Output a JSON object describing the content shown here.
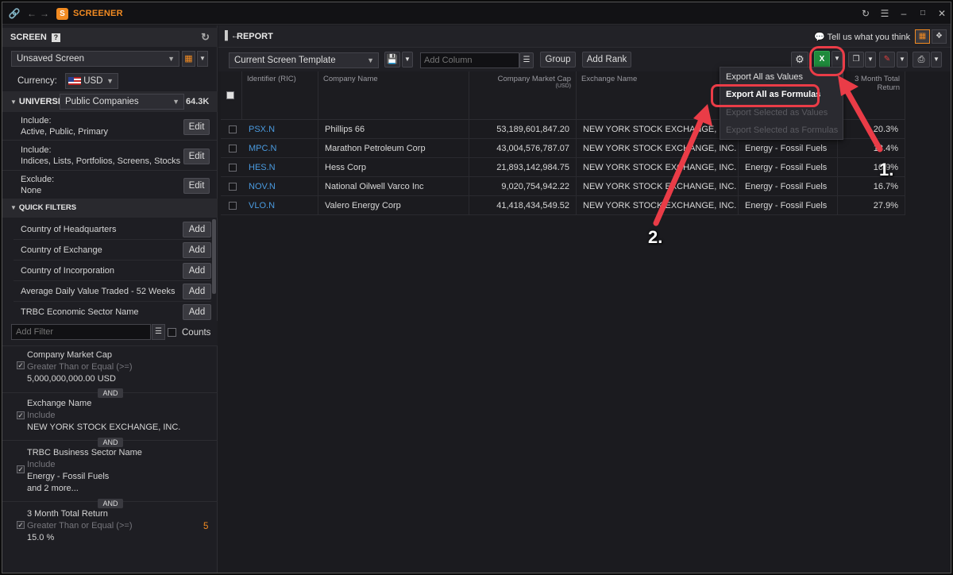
{
  "app": {
    "title": "SCREENER"
  },
  "screen_panel": {
    "title": "SCREEN",
    "screen_select": "Unsaved Screen",
    "currency_label": "Currency:",
    "currency_value": "USD",
    "universe_label": "UNIVERSE",
    "universe_value": "Public Companies",
    "universe_count": "64.3K",
    "includes": [
      {
        "label": "Include:",
        "value": "Active, Public, Primary",
        "button": "Edit"
      },
      {
        "label": "Include:",
        "value": "Indices, Lists, Portfolios, Screens, Stocks",
        "button": "Edit"
      },
      {
        "label": "Exclude:",
        "value": "None",
        "button": "Edit"
      }
    ],
    "quick_filters_title": "QUICK FILTERS",
    "quick_filters": [
      {
        "label": "Country of Headquarters",
        "button": "Add"
      },
      {
        "label": "Country of Exchange",
        "button": "Add"
      },
      {
        "label": "Country of Incorporation",
        "button": "Add"
      },
      {
        "label": "Average Daily Value Traded - 52 Weeks",
        "button": "Add"
      },
      {
        "label": "TRBC Economic Sector Name",
        "button": "Add"
      }
    ],
    "add_filter_placeholder": "Add Filter",
    "counts_label": "Counts",
    "criteria": [
      {
        "name": "Company Market Cap",
        "op": "Greater Than or Equal (>=)",
        "value": "5,000,000,000.00 USD"
      },
      {
        "name": "Exchange Name",
        "op": "Include",
        "value": "NEW YORK STOCK EXCHANGE, INC."
      },
      {
        "name": "TRBC Business Sector Name",
        "op": "Include",
        "value": "Energy - Fossil Fuels",
        "more": "and 2 more..."
      },
      {
        "name": "3 Month Total Return",
        "op": "Greater Than or Equal (>=)",
        "value": "15.0 %",
        "count": "5"
      }
    ],
    "and_label": "AND"
  },
  "report": {
    "title": "REPORT",
    "feedback": "Tell us what you think",
    "template_select": "Current Screen Template",
    "add_column_placeholder": "Add Column",
    "group_button": "Group",
    "add_rank_button": "Add Rank",
    "columns": [
      "Identifier (RIC)",
      "Company Name",
      "Company Market Cap",
      "Exchange Name",
      "",
      "3 Month Total Return"
    ],
    "market_cap_unit": "(USD)",
    "rows": [
      {
        "ric": "PSX.N",
        "name": "Phillips 66",
        "cap": "53,189,601,847.20",
        "exchange": "NEW YORK STOCK EXCHANGE, INC.",
        "sector": "",
        "ret": "20.3%"
      },
      {
        "ric": "MPC.N",
        "name": "Marathon Petroleum Corp",
        "cap": "43,004,576,787.07",
        "exchange": "NEW YORK STOCK EXCHANGE, INC.",
        "sector": "Energy - Fossil Fuels",
        "ret": "18.4%"
      },
      {
        "ric": "HES.N",
        "name": "Hess Corp",
        "cap": "21,893,142,984.75",
        "exchange": "NEW YORK STOCK EXCHANGE, INC.",
        "sector": "Energy - Fossil Fuels",
        "ret": "16.9%"
      },
      {
        "ric": "NOV.N",
        "name": "National Oilwell Varco Inc",
        "cap": "9,020,754,942.22",
        "exchange": "NEW YORK STOCK EXCHANGE, INC.",
        "sector": "Energy - Fossil Fuels",
        "ret": "16.7%"
      },
      {
        "ric": "VLO.N",
        "name": "Valero Energy Corp",
        "cap": "41,418,434,549.52",
        "exchange": "NEW YORK STOCK EXCHANGE, INC.",
        "sector": "Energy - Fossil Fuels",
        "ret": "27.9%"
      }
    ]
  },
  "export_menu": {
    "items": [
      "Export All as Values",
      "Export All as Formulas",
      "Export Selected as Values",
      "Export Selected as Formulas"
    ]
  },
  "annotations": {
    "step1": "1.",
    "step2": "2."
  },
  "colors": {
    "accent": "#f28b22",
    "link": "#4a9be0",
    "annotation": "#ea3c47",
    "excel": "#1f8a3c"
  }
}
